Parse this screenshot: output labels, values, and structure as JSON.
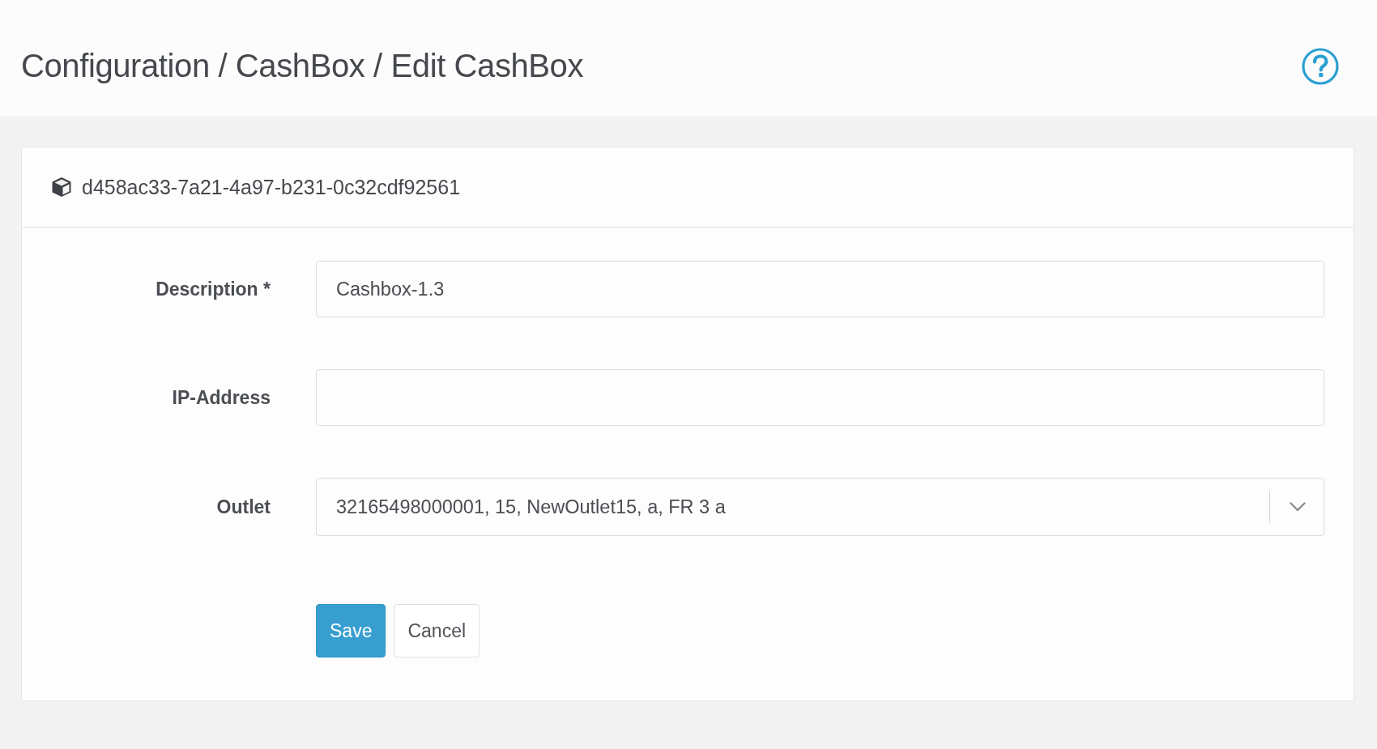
{
  "header": {
    "breadcrumb": "Configuration / CashBox / Edit CashBox"
  },
  "card": {
    "title": "d458ac33-7a21-4a97-b231-0c32cdf92561",
    "fields": [
      {
        "kind": "text",
        "label": "Description *",
        "value": "Cashbox-1.3"
      },
      {
        "kind": "text",
        "label": "IP-Address"
      },
      {
        "kind": "select",
        "label": "Outlet",
        "value": "32165498000001, 15, NewOutlet15, a, FR 3 a"
      }
    ],
    "buttons": [
      {
        "kind": "primary",
        "label": "Save"
      },
      {
        "kind": "default",
        "label": "Cancel"
      }
    ]
  }
}
